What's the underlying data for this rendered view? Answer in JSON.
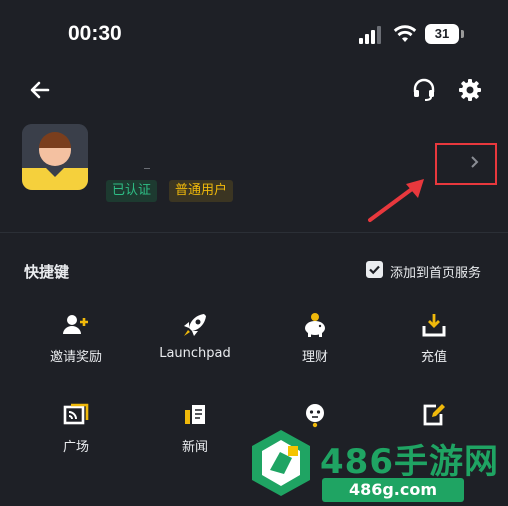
{
  "status_bar": {
    "time": "00:30",
    "battery": "31"
  },
  "nav": {
    "back_icon": "arrow-left-icon",
    "support_icon": "headset-icon",
    "settings_icon": "gear-icon"
  },
  "profile": {
    "nickname": "",
    "badges": [
      {
        "label": "已认证",
        "color": "#2ebd85"
      },
      {
        "label": "普通用户",
        "color": "#f0b90b"
      }
    ]
  },
  "shortcuts": {
    "title": "快捷键",
    "add_home_label": "添加到首页服务",
    "add_home_checked": true,
    "items": [
      {
        "label": "邀请奖励",
        "icon": "add-user-icon"
      },
      {
        "label": "Launchpad",
        "icon": "rocket-icon"
      },
      {
        "label": "理财",
        "icon": "piggy-bank-icon"
      },
      {
        "label": "充值",
        "icon": "deposit-icon"
      },
      {
        "label": "广场",
        "icon": "square-feed-icon"
      },
      {
        "label": "新闻",
        "icon": "news-icon"
      },
      {
        "label": "",
        "icon": "robot-icon"
      },
      {
        "label": "",
        "icon": "edit-icon"
      }
    ]
  },
  "watermark": {
    "title": "486手游网",
    "url": "486g.com"
  },
  "accent": {
    "yellow": "#f0b90b",
    "annotation_red": "#e8383d"
  }
}
